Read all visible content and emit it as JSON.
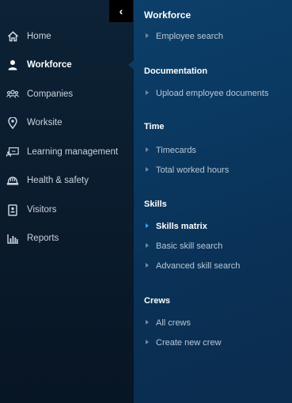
{
  "sidebar": {
    "items": [
      {
        "label": "Home",
        "icon": "home-icon"
      },
      {
        "label": "Workforce",
        "icon": "person-icon"
      },
      {
        "label": "Companies",
        "icon": "group-icon"
      },
      {
        "label": "Worksite",
        "icon": "map-pin-icon"
      },
      {
        "label": "Learning management",
        "icon": "learning-icon"
      },
      {
        "label": "Health & safety",
        "icon": "hard-hat-icon"
      },
      {
        "label": "Visitors",
        "icon": "badge-icon"
      },
      {
        "label": "Reports",
        "icon": "bar-chart-icon"
      }
    ],
    "active": "Workforce"
  },
  "panel": {
    "title": "Workforce",
    "sections": [
      {
        "heading": "",
        "links": [
          "Employee search"
        ]
      },
      {
        "heading": "Documentation",
        "links": [
          "Upload employee documents"
        ]
      },
      {
        "heading": "Time",
        "links": [
          "Timecards",
          "Total worked hours"
        ]
      },
      {
        "heading": "Skills",
        "links": [
          "Skills matrix",
          "Basic skill search",
          "Advanced skill search"
        ]
      },
      {
        "heading": "Crews",
        "links": [
          "All crews",
          "Create new crew"
        ]
      }
    ],
    "active_link": "Skills matrix"
  },
  "colors": {
    "accent": "#2aa4ff",
    "panel": "#0a3860",
    "sidebar": "#0d2236"
  }
}
